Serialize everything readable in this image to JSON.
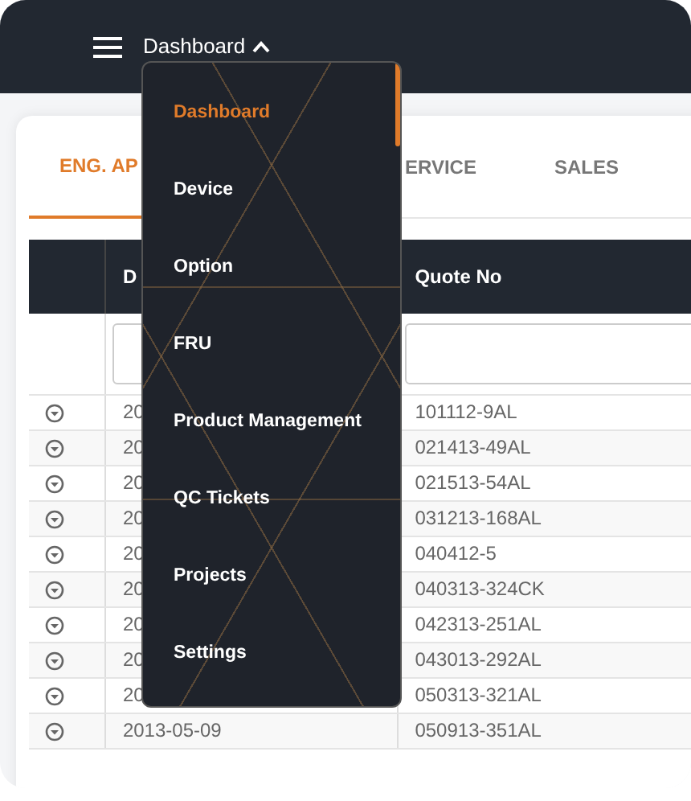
{
  "header": {
    "title": "Dashboard"
  },
  "tabs": [
    {
      "label": "ENG. AP",
      "selected": true
    },
    {
      "label": "ERVICE",
      "selected": false
    },
    {
      "label": "SALES",
      "selected": false
    }
  ],
  "table": {
    "columns": [
      "",
      "D",
      "Quote No"
    ],
    "rows": [
      {
        "date": "20",
        "quote_no": "101112-9AL"
      },
      {
        "date": "20",
        "quote_no": "021413-49AL"
      },
      {
        "date": "20",
        "quote_no": "021513-54AL"
      },
      {
        "date": "20",
        "quote_no": "031213-168AL"
      },
      {
        "date": "20",
        "quote_no": "040412-5"
      },
      {
        "date": "20",
        "quote_no": "040313-324CK"
      },
      {
        "date": "20",
        "quote_no": "042313-251AL"
      },
      {
        "date": "20",
        "quote_no": "043013-292AL"
      },
      {
        "date": "20",
        "quote_no": "050313-321AL"
      },
      {
        "date": "2013-05-09",
        "quote_no": "050913-351AL"
      }
    ]
  },
  "menu": {
    "items": [
      {
        "label": "Dashboard",
        "selected": true
      },
      {
        "label": "Device",
        "selected": false
      },
      {
        "label": "Option",
        "selected": false
      },
      {
        "label": "FRU",
        "selected": false
      },
      {
        "label": "Product Management",
        "selected": false
      },
      {
        "label": "QC Tickets",
        "selected": false
      },
      {
        "label": "Projects",
        "selected": false
      },
      {
        "label": "Settings",
        "selected": false
      }
    ]
  }
}
